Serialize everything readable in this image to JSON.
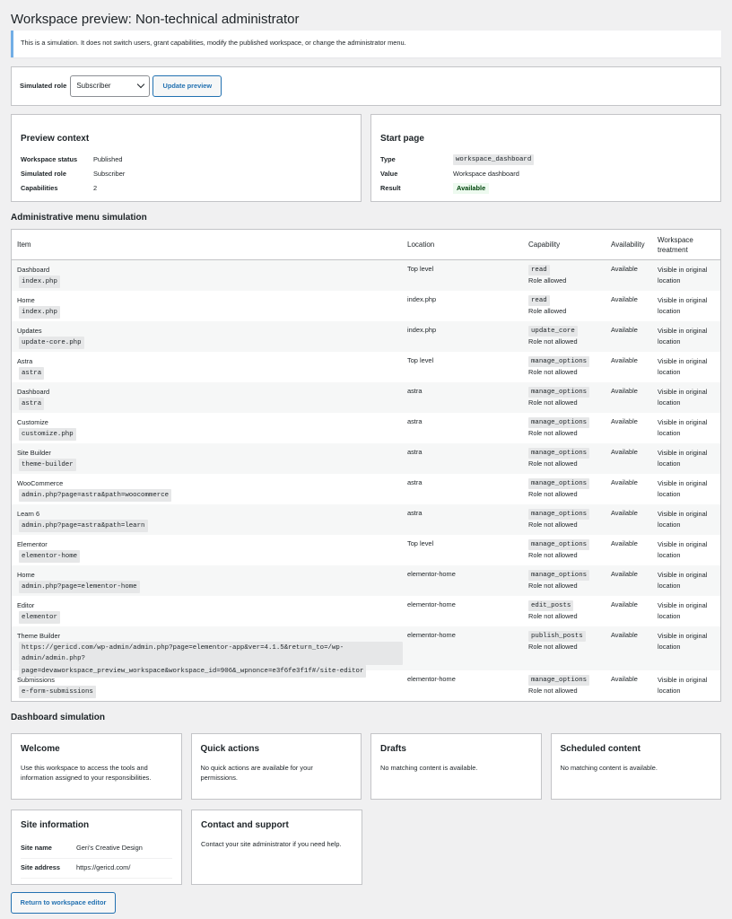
{
  "page": {
    "title": "Workspace preview: Non-technical administrator"
  },
  "notice": {
    "text": "This is a simulation. It does not switch users, grant capabilities, modify the published workspace, or change the administrator menu."
  },
  "role_bar": {
    "label": "Simulated role",
    "selected": "Subscriber",
    "button": "Update preview"
  },
  "preview_context": {
    "title": "Preview context",
    "rows": [
      {
        "key": "Workspace status",
        "value": "Published"
      },
      {
        "key": "Simulated role",
        "value": "Subscriber"
      },
      {
        "key": "Capabilities",
        "value": "2"
      }
    ]
  },
  "start_page": {
    "title": "Start page",
    "type_label": "Type",
    "type_value": "workspace_dashboard",
    "value_label": "Value",
    "value_value": "Workspace dashboard",
    "result_label": "Result",
    "result_value": "Available"
  },
  "menu_sim": {
    "title": "Administrative menu simulation",
    "headers": {
      "item": "Item",
      "location": "Location",
      "capability": "Capability",
      "availability": "Availability",
      "treatment": "Workspace treatment"
    },
    "rows": [
      {
        "name": "Dashboard",
        "slug": "index.php",
        "location": "Top level",
        "cap": "read",
        "status": "Role allowed",
        "avail": "Available",
        "treat": "Visible in original location"
      },
      {
        "name": "Home",
        "slug": "index.php",
        "location": "index.php",
        "cap": "read",
        "status": "Role allowed",
        "avail": "Available",
        "treat": "Visible in original location"
      },
      {
        "name": "Updates",
        "slug": "update-core.php",
        "location": "index.php",
        "cap": "update_core",
        "status": "Role not allowed",
        "avail": "Available",
        "treat": "Visible in original location"
      },
      {
        "name": "Astra",
        "slug": "astra",
        "location": "Top level",
        "cap": "manage_options",
        "status": "Role not allowed",
        "avail": "Available",
        "treat": "Visible in original location"
      },
      {
        "name": "Dashboard",
        "slug": "astra",
        "location": "astra",
        "cap": "manage_options",
        "status": "Role not allowed",
        "avail": "Available",
        "treat": "Visible in original location"
      },
      {
        "name": "Customize",
        "slug": "customize.php",
        "location": "astra",
        "cap": "manage_options",
        "status": "Role not allowed",
        "avail": "Available",
        "treat": "Visible in original location"
      },
      {
        "name": "Site Builder",
        "slug": "theme-builder",
        "location": "astra",
        "cap": "manage_options",
        "status": "Role not allowed",
        "avail": "Available",
        "treat": "Visible in original location"
      },
      {
        "name": "WooCommerce",
        "slug": "admin.php?page=astra&path=woocommerce",
        "location": "astra",
        "cap": "manage_options",
        "status": "Role not allowed",
        "avail": "Available",
        "treat": "Visible in original location"
      },
      {
        "name": "Learn 6",
        "slug": "admin.php?page=astra&path=learn",
        "location": "astra",
        "cap": "manage_options",
        "status": "Role not allowed",
        "avail": "Available",
        "treat": "Visible in original location"
      },
      {
        "name": "Elementor",
        "slug": "elementor-home",
        "location": "Top level",
        "cap": "manage_options",
        "status": "Role not allowed",
        "avail": "Available",
        "treat": "Visible in original location"
      },
      {
        "name": "Home",
        "slug": "admin.php?page=elementor-home",
        "location": "elementor-home",
        "cap": "manage_options",
        "status": "Role not allowed",
        "avail": "Available",
        "treat": "Visible in original location"
      },
      {
        "name": "Editor",
        "slug": "elementor",
        "location": "elementor-home",
        "cap": "edit_posts",
        "status": "Role not allowed",
        "avail": "Available",
        "treat": "Visible in original location"
      },
      {
        "name": "Theme Builder",
        "slug": "https://gericd.com/wp-admin/admin.php?page=elementor-app&ver=4.1.5&return_to=/wp-admin/admin.php?",
        "slug2": "page=devaworkspace_preview_workspace&workspace_id=906&_wpnonce=e3f6fe3f1f#/site-editor",
        "location": "elementor-home",
        "cap": "publish_posts",
        "status": "Role not allowed",
        "avail": "Available",
        "treat": "Visible in original location"
      },
      {
        "name": "Submissions",
        "slug": "e-form-submissions",
        "location": "elementor-home",
        "cap": "manage_options",
        "status": "Role not allowed",
        "avail": "Available",
        "treat": "Visible in original location"
      }
    ]
  },
  "dashboard_sim": {
    "title": "Dashboard simulation",
    "welcome": {
      "title": "Welcome",
      "text": "Use this workspace to access the tools and information assigned to your responsibilities."
    },
    "quick": {
      "title": "Quick actions",
      "text": "No quick actions are available for your permissions."
    },
    "drafts": {
      "title": "Drafts",
      "text": "No matching content is available."
    },
    "scheduled": {
      "title": "Scheduled content",
      "text": "No matching content is available."
    },
    "site_info": {
      "title": "Site information",
      "name_label": "Site name",
      "name_value": "Geri’s Creative Design",
      "addr_label": "Site address",
      "addr_value": "https://gericd.com/"
    },
    "contact": {
      "title": "Contact and support",
      "text": "Contact your site administrator if you need help."
    }
  },
  "footer": {
    "return_button": "Return to workspace editor"
  }
}
